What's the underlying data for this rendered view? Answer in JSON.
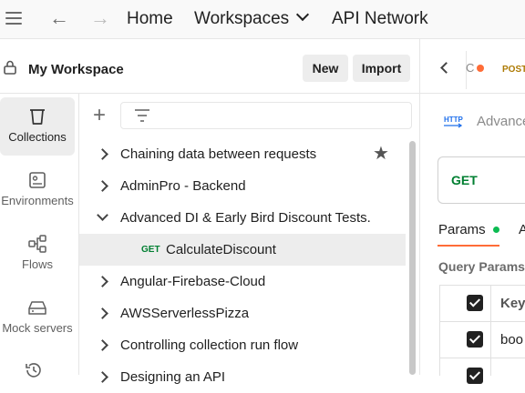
{
  "topbar": {
    "nav": [
      "Home",
      "Workspaces",
      "API Network"
    ],
    "back_icon": "←",
    "forward_icon": "→"
  },
  "workspace": {
    "title": "My Workspace",
    "new_label": "New",
    "import_label": "Import"
  },
  "rail": {
    "items": [
      {
        "label": "Collections",
        "icon": "trash-bin-icon",
        "active": true
      },
      {
        "label": "Environments",
        "icon": "environment-icon",
        "active": false
      },
      {
        "label": "Flows",
        "icon": "flows-icon",
        "active": false
      },
      {
        "label": "Mock servers",
        "icon": "mock-server-icon",
        "active": false
      }
    ]
  },
  "tree": {
    "plus": "+",
    "items": [
      {
        "label": "Chaining data between requests",
        "starred": true
      },
      {
        "label": "AdminPro - Backend"
      },
      {
        "label": "Advanced DI & Early Bird Discount Tests.",
        "expanded": true
      },
      {
        "method": "GET",
        "label": "CalculateDiscount",
        "selected": true
      },
      {
        "label": "Angular-Firebase-Cloud"
      },
      {
        "label": "AWSServerlessPizza"
      },
      {
        "label": "Controlling collection run flow"
      },
      {
        "label": "Designing an API"
      }
    ]
  },
  "right_pane": {
    "tab_partial": "C",
    "tab_method": "POST",
    "request_name": "Advanced",
    "http_icon": "HTTP",
    "url_method": "GET",
    "params_tab": "Params",
    "auth_tab_partial": "A",
    "query_params_title": "Query Params",
    "key_header": "Key",
    "row1_key": "boo"
  },
  "colors": {
    "accent": "#ff6c37",
    "get_green": "#007f31",
    "post_yellow": "#ad7a03",
    "params_dot": "#0cbb52"
  }
}
